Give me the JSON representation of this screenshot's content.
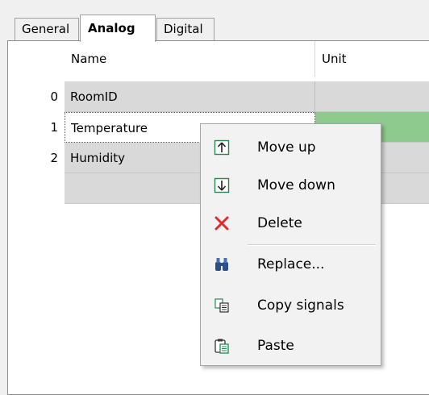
{
  "tabs": [
    "General",
    "Analog",
    "Digital"
  ],
  "active_tab": "Analog",
  "columns": [
    "Name",
    "Unit"
  ],
  "rows": [
    {
      "index": "0",
      "name": "RoomID"
    },
    {
      "index": "1",
      "name": "Temperature"
    },
    {
      "index": "2",
      "name": "Humidity"
    }
  ],
  "context_menu": {
    "items": [
      {
        "label": "Move up",
        "icon": "arrow-up-icon"
      },
      {
        "label": "Move down",
        "icon": "arrow-down-icon"
      },
      {
        "label": "Delete",
        "icon": "delete-x-icon"
      },
      {
        "label": "Replace...",
        "icon": "binoculars-icon"
      },
      {
        "label": "Copy signals",
        "icon": "copy-icon"
      },
      {
        "label": "Paste",
        "icon": "paste-icon"
      }
    ]
  },
  "colors": {
    "selected_cell": "#8ec98e",
    "delete_icon": "#e32b2b",
    "arrow_icon": "#1f8a4c",
    "grid_row": "#d9d9d9"
  }
}
